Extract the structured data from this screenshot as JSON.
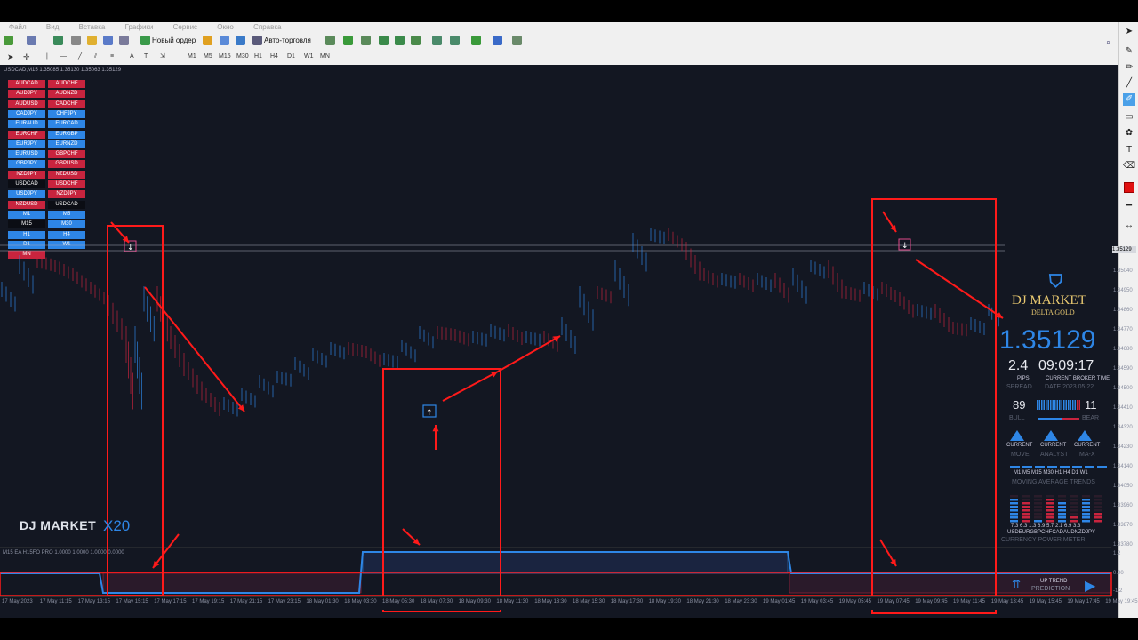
{
  "menu": [
    "Файл",
    "Вид",
    "Вставка",
    "Графики",
    "Сервис",
    "Окно",
    "Справка"
  ],
  "toolbar": {
    "new_order": "Новый ордер",
    "auto_trading": "Авто-торговля"
  },
  "timeframes": [
    "M1",
    "M5",
    "M15",
    "M30",
    "H1",
    "H4",
    "D1",
    "W1",
    "MN"
  ],
  "chart": {
    "title": "USDCAD,M15  1.35085 1.35130 1.35063 1.35129",
    "indicator_title": "M15 EA H15FO PRO 1.0000 1.0000 1.0000 0.0000",
    "current_price_tag": "1.35129",
    "brand": "DJ MARKET",
    "multiplier": "X20"
  },
  "pairs": [
    [
      "AUDCAD",
      "AUDCHF"
    ],
    [
      "AUDJPY",
      "AUDNZD"
    ],
    [
      "AUDUSD",
      "CADCHF"
    ],
    [
      "CADJPY",
      "CHFJPY"
    ],
    [
      "EURAUD",
      "EURCAD"
    ],
    [
      "EURCHF",
      "EURGBP"
    ],
    [
      "EURJPY",
      "EURNZD"
    ],
    [
      "EURUSD",
      "GBPCHF"
    ],
    [
      "GBPJPY",
      "GBPUSD"
    ],
    [
      "NZDJPY",
      "NZDUSD"
    ],
    [
      "USDCAD",
      "USDCHF"
    ],
    [
      "USDJPY",
      "NZDJPY"
    ],
    [
      "NZDUSD",
      "USDCAD"
    ],
    [
      "M1",
      "M5"
    ],
    [
      "M15",
      "M30"
    ],
    [
      "H1",
      "H4"
    ],
    [
      "D1",
      "W1"
    ],
    [
      "MN",
      ""
    ]
  ],
  "pair_colors": [
    [
      "#c8243e",
      "#c8243e"
    ],
    [
      "#c8243e",
      "#c8243e"
    ],
    [
      "#c8243e",
      "#c8243e"
    ],
    [
      "#2e86e6",
      "#2e86e6"
    ],
    [
      "#2e86e6",
      "#2e86e6"
    ],
    [
      "#c8243e",
      "#2e86e6"
    ],
    [
      "#2e86e6",
      "#2e86e6"
    ],
    [
      "#2e86e6",
      "#c8243e"
    ],
    [
      "#2e86e6",
      "#c8243e"
    ],
    [
      "#c8243e",
      "#c8243e"
    ],
    [
      "#0b0d14",
      "#c8243e"
    ],
    [
      "#2e86e6",
      "#c8243e"
    ],
    [
      "#c8243e",
      "#0b0d14"
    ],
    [
      "#2e86e6",
      "#2e86e6"
    ],
    [
      "#0b0d14",
      "#2e86e6"
    ],
    [
      "#2e86e6",
      "#2e86e6"
    ],
    [
      "#2e86e6",
      "#2e86e6"
    ],
    [
      "#c8243e",
      ""
    ]
  ],
  "panel": {
    "brand_line1": "DJ  MARKET",
    "brand_line2": "DELTA GOLD",
    "price": "1.35129",
    "spread_value": "2.4",
    "time_value": "09:09:17",
    "pips_label": "PIPS",
    "broker_time_label": "CURRENT BROKER TIME",
    "spread_label": "SPREAD",
    "date_label": "DATE 2023.05.22",
    "bull_value": "89",
    "bear_value": "11",
    "bull_label": "BULL",
    "bear_label": "BEAR",
    "current_labels": [
      "CURRENT",
      "CURRENT",
      "CURRENT"
    ],
    "sub_labels": [
      "MOVE",
      "ANALYST",
      "MA-X"
    ],
    "tf_row": "M1  M5 M15 M30  H1  H4  D1  W1",
    "ma_label": "MOVING  AVERAGE  TRENDS",
    "strength_values": "7.3 6.3 1.3 6.9 5.7 2.1 6.9 3.3",
    "currencies": "USDEURGBPCHFCADAUDNZDJPY",
    "meter_label": "CURRENCY  POWER  METER",
    "up_trend": "UP TREND",
    "prediction": "PREDICTION"
  },
  "price_axis": [
    "1.35129",
    "1.35040",
    "1.34950",
    "1.34860",
    "1.34770",
    "1.34680",
    "1.34590",
    "1.34500",
    "1.34410",
    "1.34320",
    "1.34230",
    "1.34140",
    "1.34050",
    "1.33960",
    "1.33870",
    "1.33780",
    "1.2",
    "0.00",
    "-1.2"
  ],
  "time_axis": [
    "17 May 2023",
    "17 May 11:15",
    "17 May 13:15",
    "17 May 15:15",
    "17 May 17:15",
    "17 May 19:15",
    "17 May 21:15",
    "17 May 23:15",
    "18 May 01:30",
    "18 May 03:30",
    "18 May 05:30",
    "18 May 07:30",
    "18 May 09:30",
    "18 May 11:30",
    "18 May 13:30",
    "18 May 15:30",
    "18 May 17:30",
    "18 May 19:30",
    "18 May 21:30",
    "18 May 23:30",
    "19 May 01:45",
    "19 May 03:45",
    "19 May 05:45",
    "19 May 07:45",
    "19 May 09:45",
    "19 May 11:45",
    "19 May 13:45",
    "19 May 15:45",
    "19 May 17:45",
    "19 May 19:45"
  ],
  "colors": {
    "bg": "#131722",
    "bull": "#2e86e6",
    "bear": "#c8243e",
    "annotation": "#ff1a1a"
  }
}
